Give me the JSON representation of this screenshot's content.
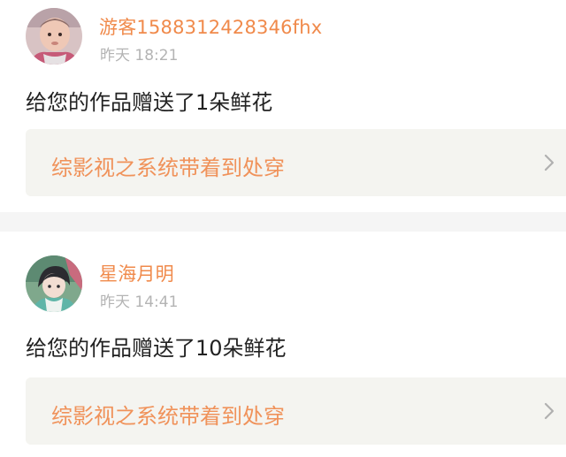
{
  "notifications": [
    {
      "username": "游客1588312428346fhx",
      "timestamp": "昨天 18:21",
      "message": "给您的作品赠送了1朵鲜花",
      "work_title": "综影视之系统带着到处穿",
      "avatar": "baby-photo-avatar",
      "link_icon": "chevron-right-icon"
    },
    {
      "username": "星海月明",
      "timestamp": "昨天 14:41",
      "message": "给您的作品赠送了10朵鲜花",
      "work_title": "综影视之系统带着到处穿",
      "avatar": "anime-girl-avatar",
      "link_icon": "chevron-right-icon"
    }
  ],
  "colors": {
    "username": "#f08a4b",
    "timestamp": "#b4b4b4",
    "message": "#222222",
    "link_background": "#f4f4f0",
    "separator": "#f5f5f5"
  }
}
